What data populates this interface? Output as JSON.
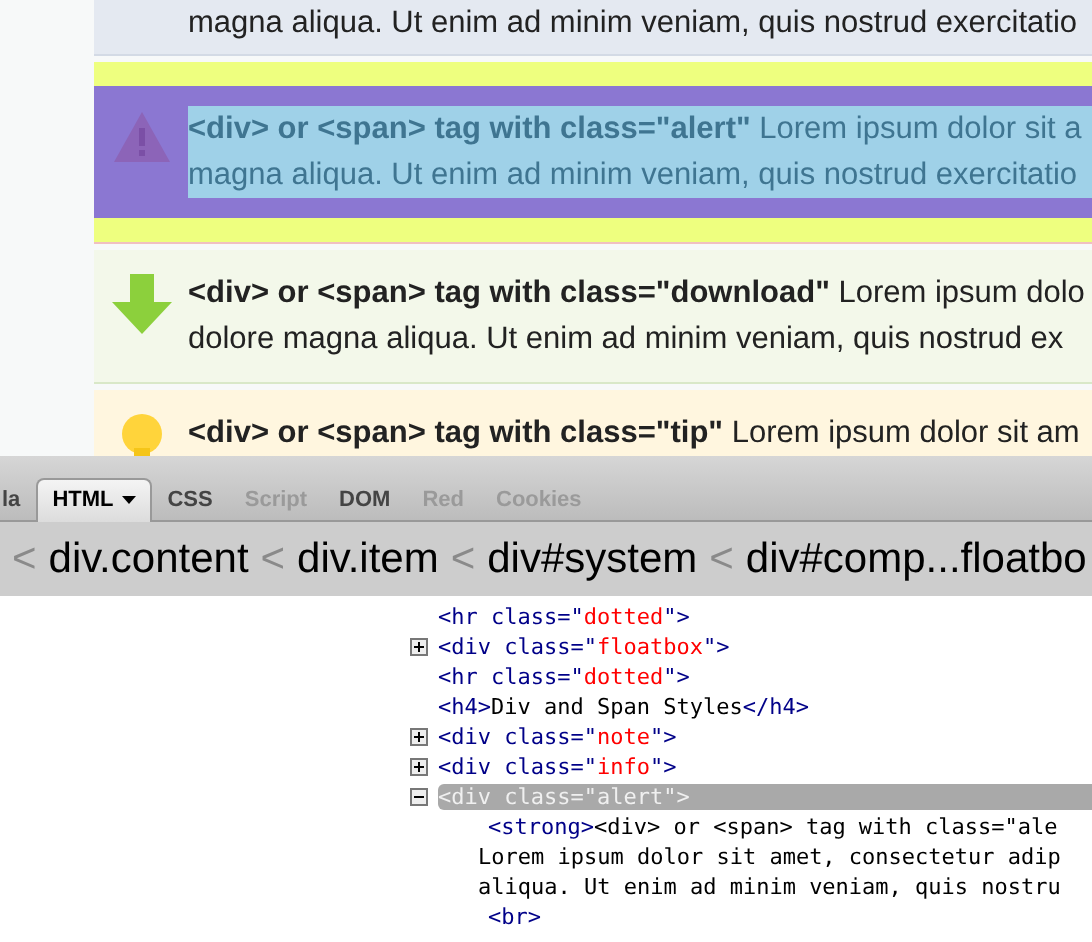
{
  "page": {
    "items": [
      {
        "kind": "info",
        "inspected": false,
        "lines": [
          "magna aliqua. Ut enim ad minim veniam, quis nostrud exercitatio"
        ]
      },
      {
        "kind": "alert",
        "inspected": true,
        "lines": [
          "**<div> or <span> tag with class=\"alert\"** Lorem ipsum dolor sit a",
          "magna aliqua. Ut enim ad minim veniam, quis nostrud exercitatio"
        ]
      },
      {
        "kind": "download",
        "inspected": false,
        "lines": [
          "**<div> or <span> tag with class=\"download\"** Lorem ipsum dolo",
          "dolore magna aliqua. Ut enim ad minim veniam, quis nostrud ex"
        ]
      },
      {
        "kind": "tip",
        "inspected": false,
        "lines": [
          "**<div> or <span> tag with class=\"tip\"** Lorem ipsum dolor sit am"
        ]
      }
    ]
  },
  "devtools": {
    "tabs": [
      {
        "label": "la",
        "selected": false,
        "disabled": false,
        "menu": false
      },
      {
        "label": "HTML",
        "selected": true,
        "disabled": false,
        "menu": true
      },
      {
        "label": "CSS",
        "selected": false,
        "disabled": false,
        "menu": false
      },
      {
        "label": "Script",
        "selected": false,
        "disabled": true,
        "menu": false
      },
      {
        "label": "DOM",
        "selected": false,
        "disabled": false,
        "menu": false
      },
      {
        "label": "Red",
        "selected": false,
        "disabled": true,
        "menu": false
      },
      {
        "label": "Cookies",
        "selected": false,
        "disabled": true,
        "menu": false
      }
    ],
    "breadcrumb": [
      {
        "separator": "<",
        "label": "div.content"
      },
      {
        "separator": "<",
        "label": "div.item"
      },
      {
        "separator": "<",
        "label": "div#system"
      },
      {
        "separator": "<",
        "label": "div#comp...floatbo"
      }
    ],
    "tree": [
      {
        "selected": false,
        "tokens": [
          {
            "kind": "tag",
            "text": "<hr class=\""
          },
          {
            "kind": "value",
            "text": "dotted"
          },
          {
            "kind": "tag",
            "text": "\">"
          }
        ]
      },
      {
        "expandable": true,
        "expanded": false,
        "selected": false,
        "tokens": [
          {
            "kind": "tag",
            "text": "<div class=\""
          },
          {
            "kind": "value",
            "text": "floatbox"
          },
          {
            "kind": "tag",
            "text": "\">"
          }
        ]
      },
      {
        "selected": false,
        "tokens": [
          {
            "kind": "tag",
            "text": "<hr class=\""
          },
          {
            "kind": "value",
            "text": "dotted"
          },
          {
            "kind": "tag",
            "text": "\">"
          }
        ]
      },
      {
        "selected": false,
        "tokens": [
          {
            "kind": "tag",
            "text": "<h4>"
          },
          {
            "kind": "text",
            "text": "Div and Span Styles"
          },
          {
            "kind": "tag",
            "text": "</h4>"
          }
        ]
      },
      {
        "expandable": true,
        "expanded": false,
        "selected": false,
        "tokens": [
          {
            "kind": "tag",
            "text": "<div class=\""
          },
          {
            "kind": "value",
            "text": "note"
          },
          {
            "kind": "tag",
            "text": "\">"
          }
        ]
      },
      {
        "expandable": true,
        "expanded": false,
        "selected": false,
        "tokens": [
          {
            "kind": "tag",
            "text": "<div class=\""
          },
          {
            "kind": "value",
            "text": "info"
          },
          {
            "kind": "tag",
            "text": "\">"
          }
        ]
      },
      {
        "expandable": true,
        "expanded": true,
        "selected": true,
        "tokens": [
          {
            "kind": "tag",
            "text": "<div class=\""
          },
          {
            "kind": "value",
            "text": "alert"
          },
          {
            "kind": "tag",
            "text": "\">"
          }
        ],
        "children": [
          {
            "selected": false,
            "tokens": [
              {
                "kind": "tag",
                "text": "<strong>"
              },
              {
                "kind": "text",
                "text": "<div> or <span> tag with class=\"ale"
              }
            ]
          },
          {
            "selected": false,
            "tokens": [
              {
                "kind": "text",
                "text": "Lorem ipsum dolor sit amet, consectetur adip"
              }
            ]
          },
          {
            "selected": false,
            "tokens": [
              {
                "kind": "text",
                "text": "aliqua. Ut enim ad minim veniam, quis nostru"
              }
            ]
          },
          {
            "selected": false,
            "tokens": [
              {
                "kind": "tag",
                "text": "<br>"
              }
            ]
          }
        ]
      }
    ]
  }
}
